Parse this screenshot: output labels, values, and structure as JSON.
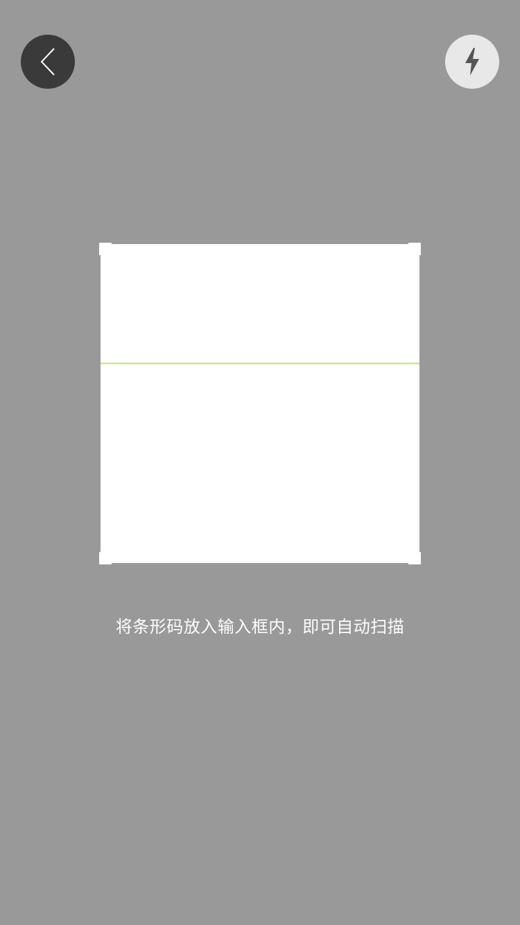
{
  "colors": {
    "background": "#999999",
    "back_button_bg": "#3a3a3a",
    "flash_button_bg": "#e8e8e8",
    "scan_frame": "#ffffff",
    "scan_line": "#c6e48b",
    "hint_text": "#ffffff"
  },
  "top_bar": {
    "back_icon": "chevron-left-icon",
    "flash_icon": "lightning-bolt-icon"
  },
  "scanner": {
    "hint": "将条形码放入输入框内，即可自动扫描"
  }
}
